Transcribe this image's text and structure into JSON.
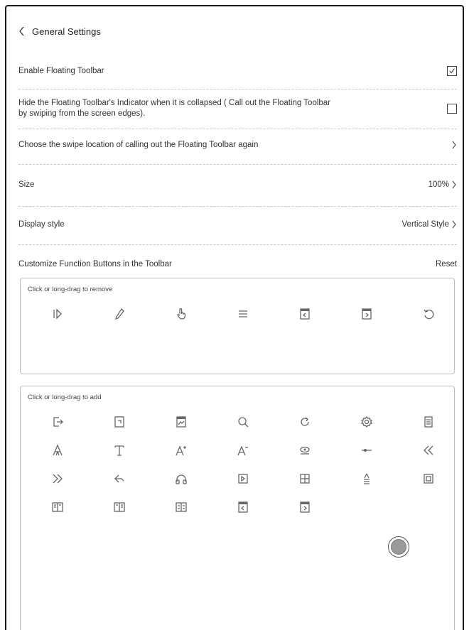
{
  "header": {
    "title": "General Settings"
  },
  "settings": {
    "enable_floating_toolbar": {
      "label": "Enable Floating Toolbar",
      "checked": true
    },
    "hide_indicator": {
      "label_line1": "Hide the Floating Toolbar's Indicator when it is collapsed ( Call out the Floating Toolbar",
      "label_line2": "by swiping from the screen edges).",
      "checked": false
    },
    "swipe_location": {
      "label": "Choose the swipe location of calling out the Floating Toolbar again"
    },
    "size": {
      "label": "Size",
      "value": "100%"
    },
    "display_style": {
      "label": "Display style",
      "value": "Vertical Style"
    },
    "customize": {
      "label": "Customize Function Buttons in the Toolbar",
      "reset_label": "Reset"
    }
  },
  "remove_panel": {
    "label": "Click or long-drag to remove",
    "icons": [
      "collapse-toolbar-icon",
      "pen-icon",
      "hand-touch-icon",
      "menu-lines-icon",
      "page-previous-icon",
      "page-next-icon",
      "undo-icon"
    ]
  },
  "add_panel": {
    "label": "Click or long-drag to add",
    "icons": [
      "exit-icon",
      "screenshot-icon",
      "image-icon",
      "search-icon",
      "refresh-icon",
      "settings-gear-icon",
      "notes-list-icon",
      "font-outline-icon",
      "font-serif-icon",
      "font-increase-icon",
      "font-decrease-icon",
      "eye-view-icon",
      "line-slider-icon",
      "double-chevron-left-icon",
      "double-chevron-right-icon",
      "back-arrow-icon",
      "headphones-icon",
      "book-bookmark-icon",
      "grid-layout-icon",
      "text-align-icon",
      "image-frame-icon",
      "book-split-left-icon",
      "book-split-right-icon",
      "book-split-icon",
      "page-previous-icon",
      "page-next-icon"
    ]
  },
  "floating_button": {
    "name": "floating-toolbar-button"
  },
  "colors": {
    "text": "#333333",
    "border": "#1a1a1a",
    "separator": "#c8c8c8",
    "icon": "#666666"
  }
}
